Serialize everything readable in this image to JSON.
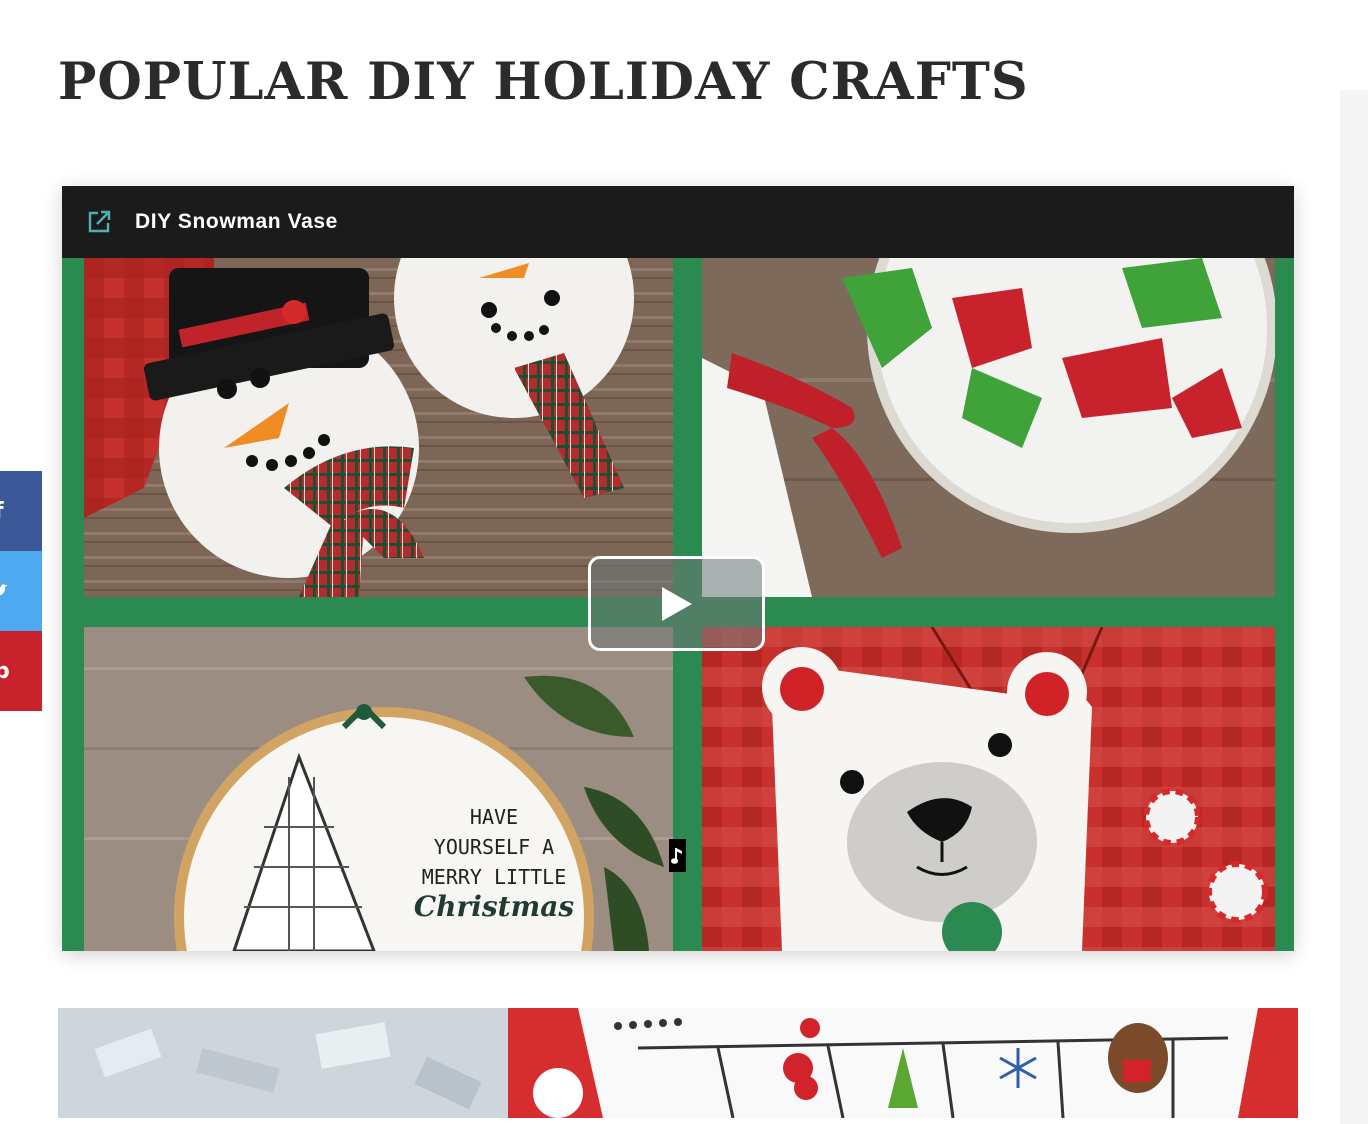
{
  "page": {
    "title": "POPULAR DIY HOLIDAY CRAFTS"
  },
  "share": {
    "facebook_icon": "f",
    "twitter_icon": "twitter-bird",
    "pinterest_icon": "p",
    "colors": {
      "facebook": "#3b5998",
      "twitter": "#4eaaf0",
      "pinterest": "#c8232c"
    }
  },
  "video": {
    "title": "DIY Snowman Vase",
    "header_icon": "external-link-icon",
    "accent": "#2b8a4f",
    "embroidery_text": [
      "HAVE",
      "YOURSELF A",
      "MERRY LITTLE",
      "Christmas"
    ]
  }
}
